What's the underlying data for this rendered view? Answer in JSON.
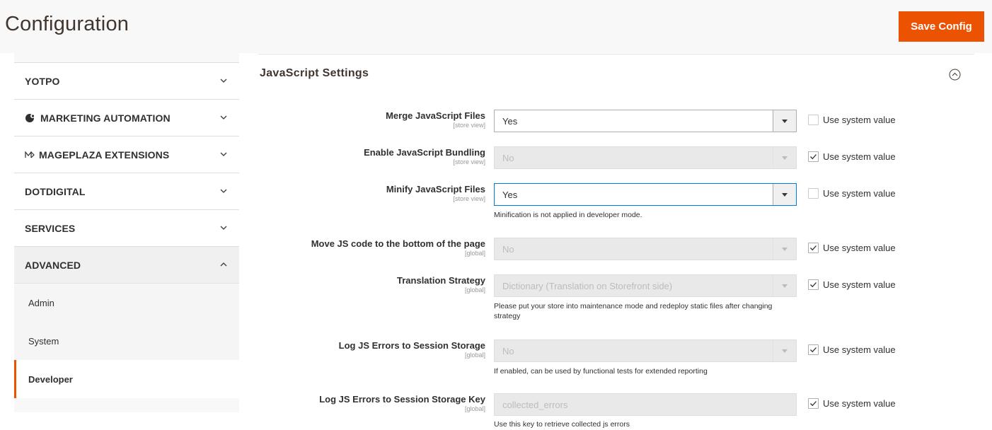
{
  "header": {
    "title": "Configuration",
    "save_label": "Save Config"
  },
  "sidebar": {
    "sections": [
      {
        "label": "YOTPO"
      },
      {
        "label": "MARKETING AUTOMATION"
      },
      {
        "label": "MAGEPLAZA EXTENSIONS"
      },
      {
        "label": "DOTDIGITAL"
      },
      {
        "label": "SERVICES"
      },
      {
        "label": "ADVANCED"
      }
    ],
    "sub_items": [
      {
        "label": "Admin"
      },
      {
        "label": "System"
      },
      {
        "label": "Developer"
      }
    ],
    "active_sub_item": "Developer"
  },
  "section": {
    "title": "JavaScript Settings"
  },
  "fields": [
    {
      "label": "Merge JavaScript Files",
      "scope": "[store view]",
      "value": "Yes",
      "use_system": false,
      "disabled": false,
      "note": ""
    },
    {
      "label": "Enable JavaScript Bundling",
      "scope": "[store view]",
      "value": "No",
      "use_system": true,
      "disabled": true,
      "note": ""
    },
    {
      "label": "Minify JavaScript Files",
      "scope": "[store view]",
      "value": "Yes",
      "use_system": false,
      "disabled": false,
      "note": "Minification is not applied in developer mode."
    },
    {
      "label": "Move JS code to the bottom of the page",
      "scope": "[global]",
      "value": "No",
      "use_system": true,
      "disabled": true,
      "note": ""
    },
    {
      "label": "Translation Strategy",
      "scope": "[global]",
      "value": "Dictionary (Translation on Storefront side)",
      "use_system": true,
      "disabled": true,
      "note": "Please put your store into maintenance mode and redeploy static files after changing strategy"
    },
    {
      "label": "Log JS Errors to Session Storage",
      "scope": "[global]",
      "value": "No",
      "use_system": true,
      "disabled": true,
      "note": "If enabled, can be used by functional tests for extended reporting"
    },
    {
      "label": "Log JS Errors to Session Storage Key",
      "scope": "[global]",
      "value": "collected_errors",
      "use_system": true,
      "disabled": true,
      "note": "Use this key to retrieve collected js errors"
    }
  ],
  "use_system_label": "Use system value",
  "colors": {
    "accent": "#eb5202",
    "focus": "#007bdb"
  }
}
